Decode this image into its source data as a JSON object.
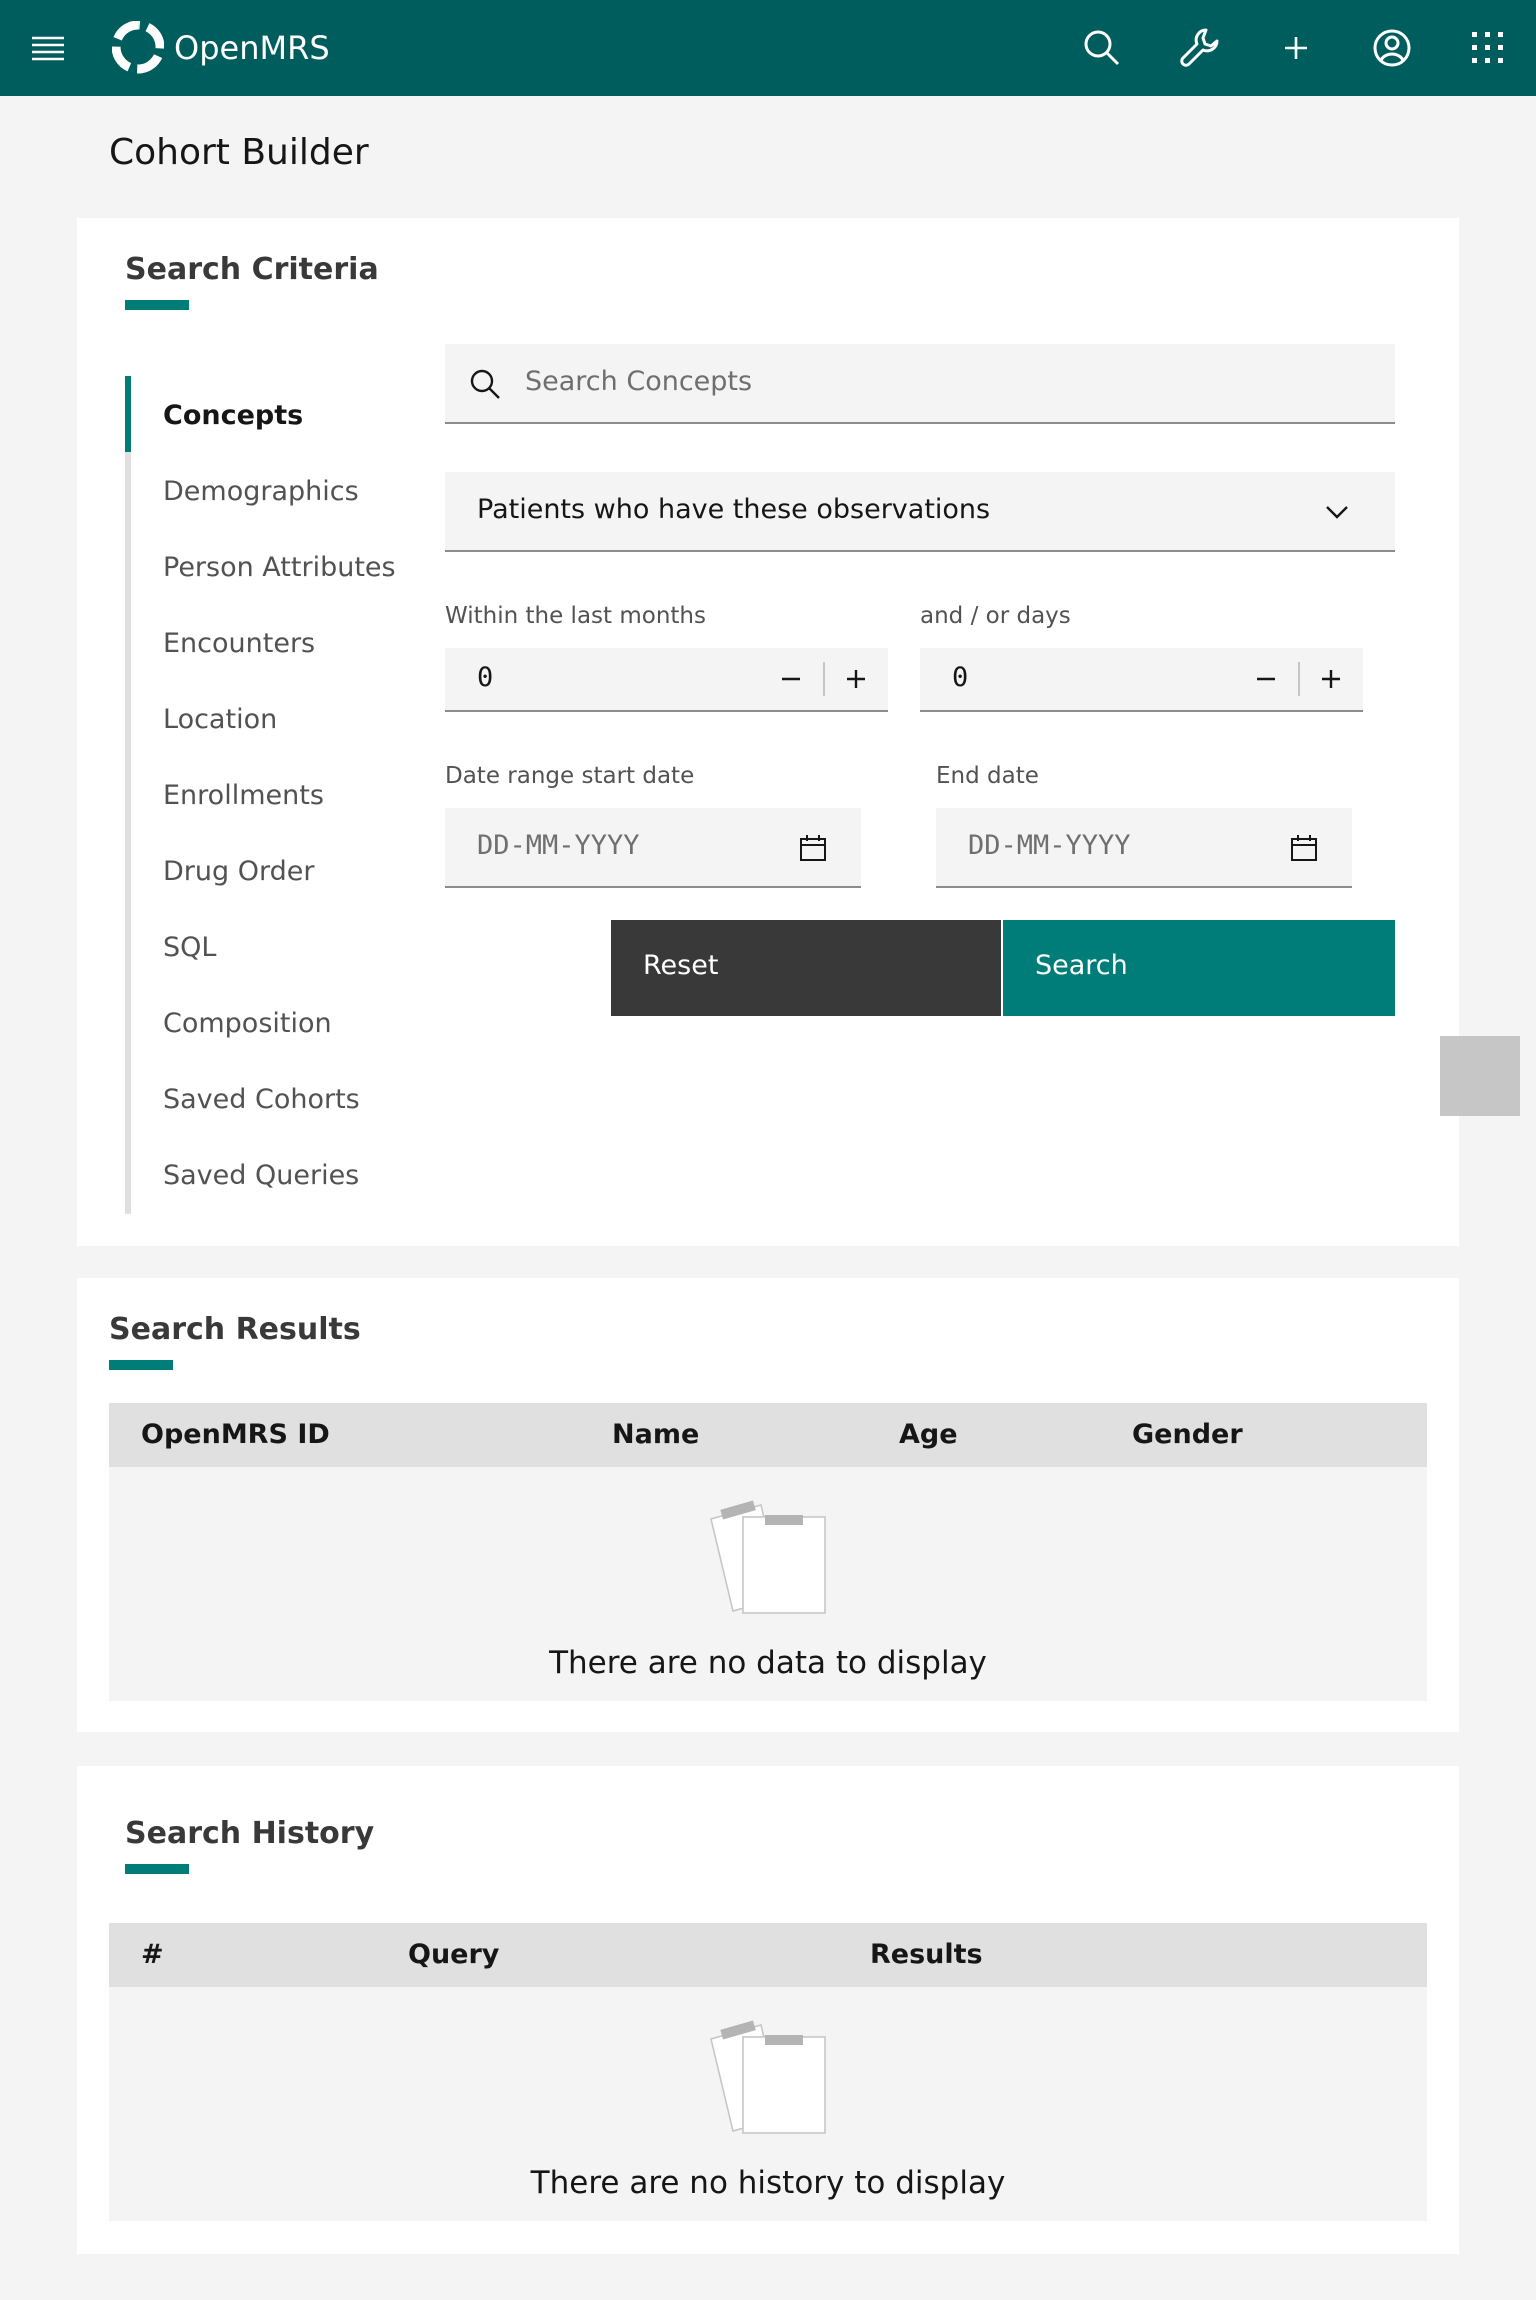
{
  "header": {
    "app_name": "OpenMRS",
    "icons": [
      "hamburger-menu-icon",
      "search-icon",
      "wrench-icon",
      "add-icon",
      "user-avatar-icon",
      "app-switcher-icon"
    ]
  },
  "page": {
    "title": "Cohort Builder"
  },
  "search_criteria": {
    "title": "Search Criteria",
    "nav": [
      {
        "label": "Concepts",
        "active": true
      },
      {
        "label": "Demographics"
      },
      {
        "label": "Person Attributes"
      },
      {
        "label": "Encounters"
      },
      {
        "label": "Location"
      },
      {
        "label": "Enrollments"
      },
      {
        "label": "Drug Order"
      },
      {
        "label": "SQL"
      },
      {
        "label": "Composition"
      },
      {
        "label": "Saved Cohorts"
      },
      {
        "label": "Saved Queries"
      }
    ],
    "search_placeholder": "Search Concepts",
    "observation_dropdown": "Patients who have these observations",
    "months_label": "Within the last months",
    "months_value": "0",
    "days_label": "and / or days",
    "days_value": "0",
    "start_date_label": "Date range start date",
    "start_date_placeholder": "DD-MM-YYYY",
    "end_date_label": "End date",
    "end_date_placeholder": "DD-MM-YYYY",
    "reset_label": "Reset",
    "search_label": "Search"
  },
  "search_results": {
    "title": "Search Results",
    "columns": [
      "OpenMRS ID",
      "Name",
      "Age",
      "Gender"
    ],
    "empty_message": "There are no data to display"
  },
  "search_history": {
    "title": "Search History",
    "columns": [
      "#",
      "Query",
      "Results"
    ],
    "empty_message": "There are no history to display"
  },
  "colors": {
    "brand": "#005d5d",
    "accent": "#007d79",
    "reset_button": "#393939"
  }
}
